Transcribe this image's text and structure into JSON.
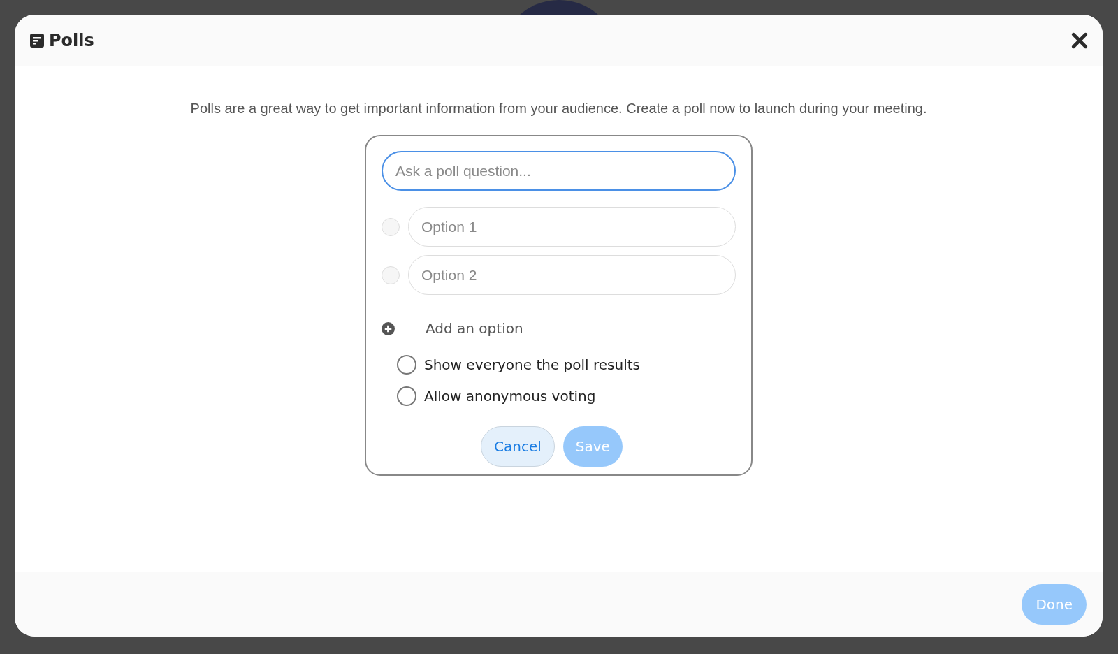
{
  "dialog": {
    "title": "Polls",
    "intro": "Polls are a great way to get important information from your audience. Create a poll now to launch during your meeting."
  },
  "poll_form": {
    "question": {
      "placeholder": "Ask a poll question..."
    },
    "options": [
      {
        "placeholder": "Option 1",
        "selected": false
      },
      {
        "placeholder": "Option 2",
        "selected": false
      }
    ],
    "add_option": "Add an option",
    "settings": [
      {
        "label": "Show everyone the poll results",
        "checked": false
      },
      {
        "label": "Allow anonymous voting",
        "checked": false
      }
    ],
    "buttons": [
      {
        "label": "Cancel",
        "kind": "secondary",
        "disabled": false
      },
      {
        "label": "Save",
        "kind": "primary",
        "disabled": true
      }
    ]
  },
  "footer": {
    "done": {
      "label": "Done",
      "disabled": true
    }
  }
}
